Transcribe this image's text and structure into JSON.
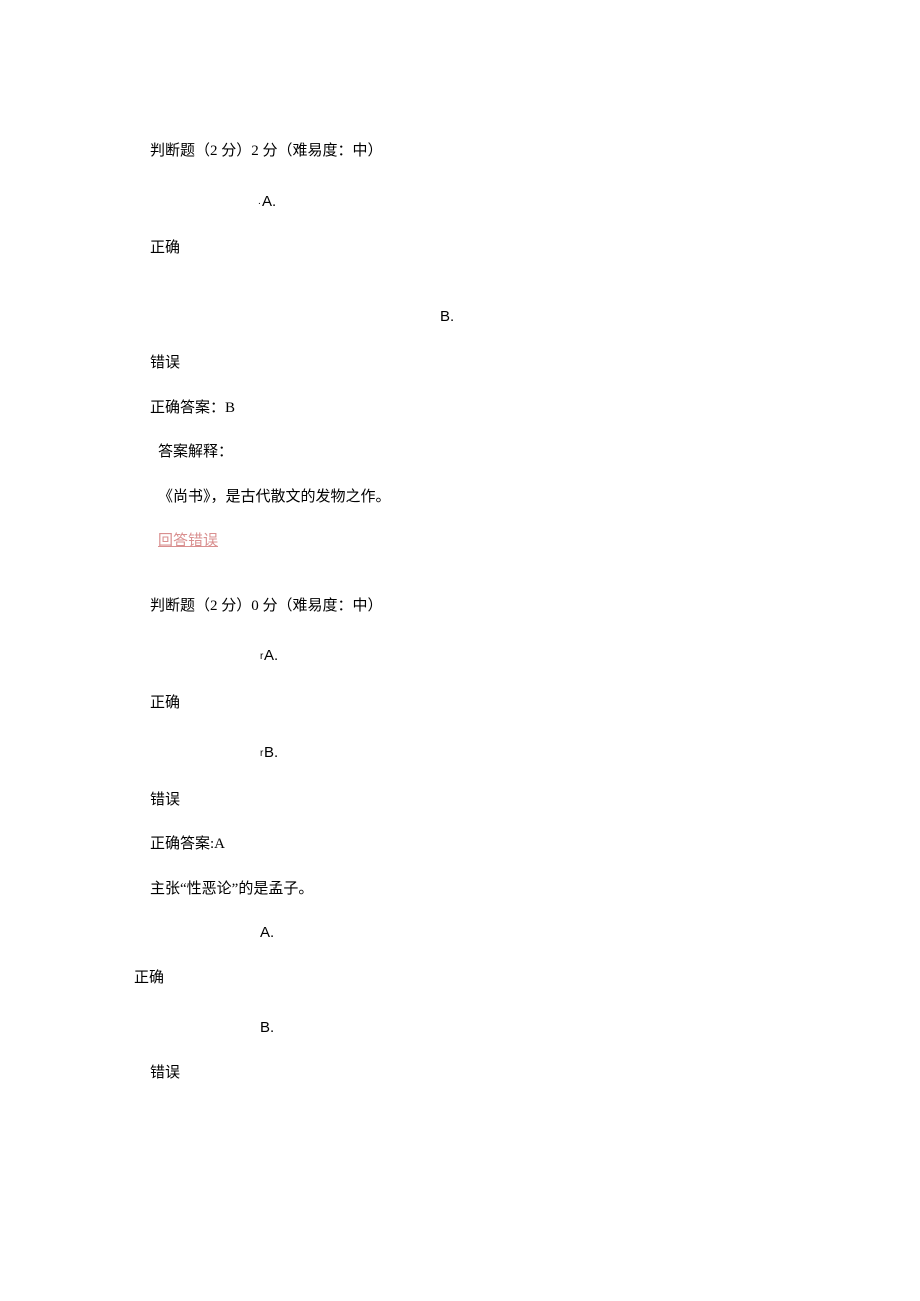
{
  "q1": {
    "header": "判断题（2 分）2 分（难易度：中）",
    "optA": "A.",
    "optA_prefix": ".",
    "optA_text": "正确",
    "optB": "B.",
    "optB_text": "错误",
    "correct": "正确答案：B",
    "explain_label": "答案解释：",
    "explain_text": "《尚书》，是古代散文的发物之作。",
    "feedback": "回答错误"
  },
  "q2": {
    "header": "判断题（2 分）0 分（难易度：中）",
    "optA": "A.",
    "optA_prefix": "r",
    "optA_text": "正确",
    "optB": "B.",
    "optB_prefix": "r",
    "optB_text": "错误",
    "correct": "正确答案:A",
    "stem": "主张“性恶论”的是孟子。"
  },
  "q3": {
    "optA": "A.",
    "optA_text": "正确",
    "optB": "B.",
    "optB_text": "错误"
  }
}
